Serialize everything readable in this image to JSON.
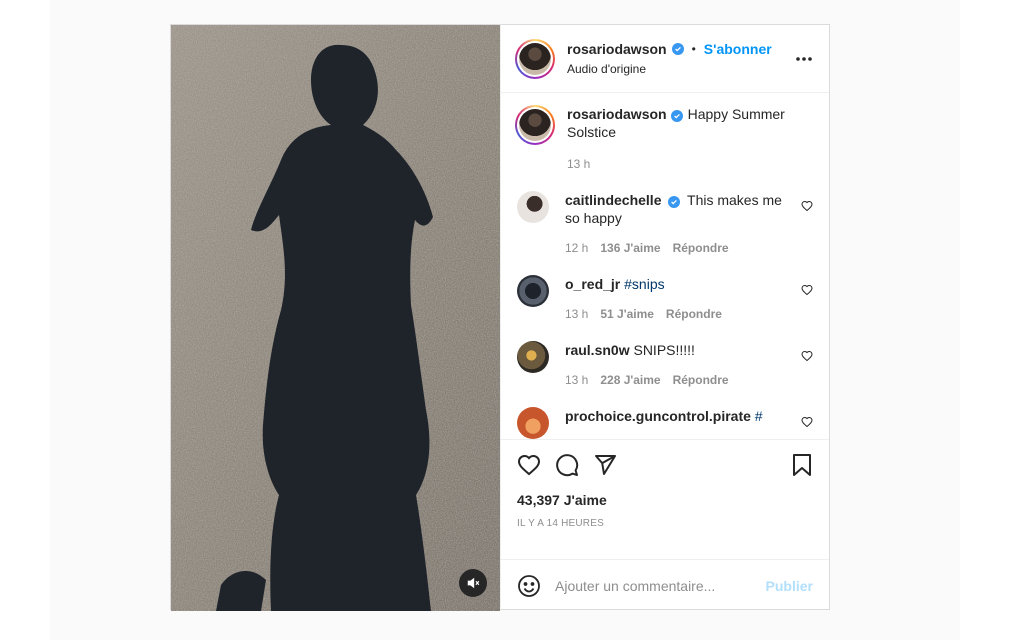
{
  "post": {
    "username": "rosariodawson",
    "separator": "•",
    "follow_label": "S'abonner",
    "audio": "Audio d'origine",
    "caption": {
      "username": "rosariodawson",
      "text": "Happy Summer Solstice",
      "time": "13 h"
    },
    "comments": [
      {
        "username": "caitlindechelle",
        "verified": true,
        "text": "This makes me so happy",
        "time": "12 h",
        "likes": "136 J'aime",
        "reply": "Répondre",
        "avatar_color": "#d9d4cf"
      },
      {
        "username": "o_red_jr",
        "verified": false,
        "text": "#snips",
        "time": "13 h",
        "likes": "51 J'aime",
        "reply": "Répondre",
        "avatar_color": "#3d4450"
      },
      {
        "username": "raul.sn0w",
        "verified": false,
        "text": "SNIPS!!!!!",
        "time": "13 h",
        "likes": "228 J'aime",
        "reply": "Répondre",
        "avatar_color": "#6b5a3e"
      },
      {
        "username": "prochoice.guncontrol.pirate",
        "verified": false,
        "text": "#",
        "time": "",
        "likes": "",
        "reply": "",
        "avatar_color": "#c8562c"
      }
    ],
    "likes_count": "43,397 J'aime",
    "time_ago": "IL Y A 14 HEURES",
    "add_comment_placeholder": "Ajouter un commentaire...",
    "publish_label": "Publier"
  },
  "colors": {
    "accent": "#0095f6",
    "verified": "#3897f0",
    "muted_text": "#8e8e8e",
    "hashtag": "#00376b"
  },
  "icons": {
    "header": [
      "verified-badge-icon",
      "more-options-icon"
    ],
    "actions": [
      "heart-icon",
      "comment-icon",
      "share-icon",
      "bookmark-icon"
    ],
    "other": [
      "mute-icon",
      "emoji-icon",
      "heart-small-icon"
    ]
  }
}
